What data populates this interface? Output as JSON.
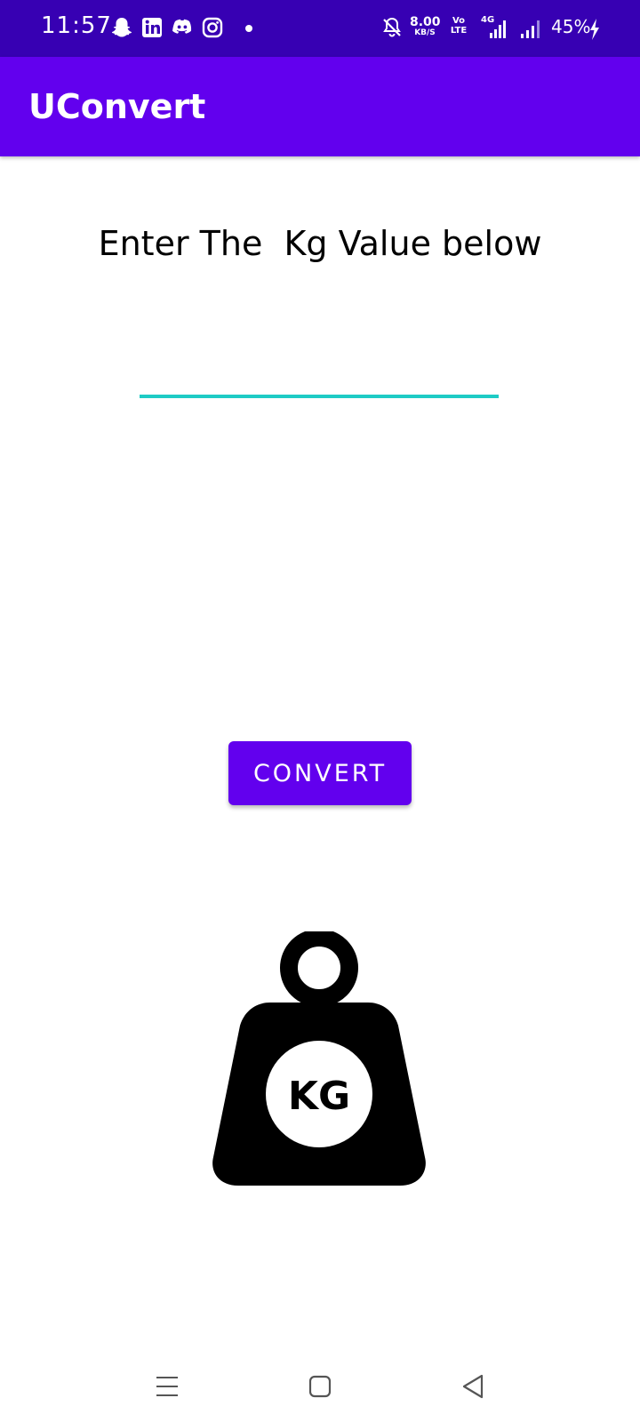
{
  "status_bar": {
    "time": "11:57",
    "net_speed_value": "8.00",
    "net_speed_unit": "KB/S",
    "volte_line1": "Vo",
    "volte_line2": "LTE",
    "network_type": "4G",
    "battery": "45%",
    "icons": [
      "snapchat-icon",
      "linkedin-icon",
      "discord-icon",
      "instagram-icon",
      "silent-icon",
      "signal-icon",
      "battery-charging-icon"
    ]
  },
  "app_bar": {
    "title": "UConvert"
  },
  "main": {
    "prompt": "Enter The  Kg Value below",
    "kg_input": {
      "value": "",
      "placeholder": ""
    },
    "convert_label": "CONVERT",
    "weight_icon_text": "KG"
  },
  "nav_bar": {
    "icons": [
      "menu-icon",
      "home-icon",
      "back-icon"
    ]
  },
  "colors": {
    "status_bar": "#3700b3",
    "primary": "#6200ee",
    "input_underline": "#1ecbc5",
    "text": "#000000",
    "background": "#ffffff"
  }
}
